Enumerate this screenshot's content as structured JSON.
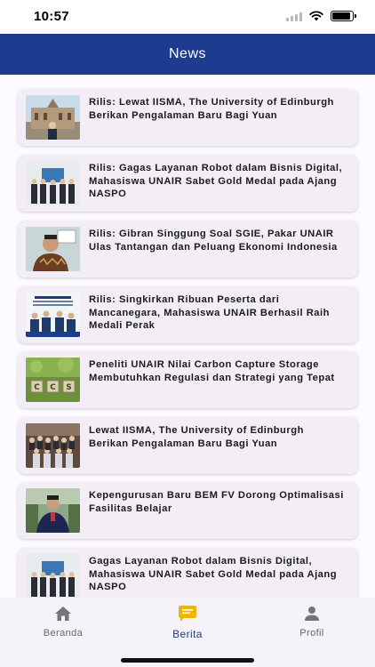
{
  "status_bar": {
    "time": "10:57",
    "battery_level": 0.9
  },
  "header": {
    "title": "News"
  },
  "news": [
    {
      "title": "Rilis: Lewat IISMA, The University of Edinburgh Berikan Pengalaman Baru Bagi Yuan",
      "thumbnail": "campus-building"
    },
    {
      "title": "Rilis: Gagas Layanan Robot dalam Bisnis Digital, Mahasiswa UNAIR Sabet Gold Medal pada Ajang NASPO",
      "thumbnail": "award-group"
    },
    {
      "title": "Rilis: Gibran Singgung Soal SGIE, Pakar UNAIR Ulas Tantangan dan Peluang Ekonomi Indonesia",
      "thumbnail": "portrait-batik"
    },
    {
      "title": "Rilis: Singkirkan Ribuan Peserta dari Mancanegara, Mahasiswa UNAIR Berhasil Raih Medali Perak",
      "thumbnail": "poster-students"
    },
    {
      "title": "Peneliti UNAIR Nilai Carbon Capture Storage Membutuhkan Regulasi dan Strategi yang Tepat",
      "thumbnail": "ccs-blocks"
    },
    {
      "title": "Lewat IISMA, The University of Edinburgh Berikan Pengalaman Baru Bagi Yuan",
      "thumbnail": "group-photo"
    },
    {
      "title": "Kepengurusan Baru BEM FV Dorong Optimalisasi Fasilitas Belajar",
      "thumbnail": "portrait-outdoor"
    },
    {
      "title": "Gagas Layanan Robot dalam Bisnis Digital, Mahasiswa UNAIR Sabet Gold Medal pada Ajang NASPO",
      "thumbnail": "award-group"
    }
  ],
  "bottom_nav": [
    {
      "label": "Beranda",
      "icon": "home-icon",
      "active": false
    },
    {
      "label": "Berita",
      "icon": "news-chat-icon",
      "active": true
    },
    {
      "label": "Profil",
      "icon": "person-icon",
      "active": false
    }
  ],
  "colors": {
    "primary": "#1e3c8f",
    "active_icon": "#f2b400",
    "card_bg": "#f3eef6",
    "nav_bg": "#f6f2fa"
  }
}
